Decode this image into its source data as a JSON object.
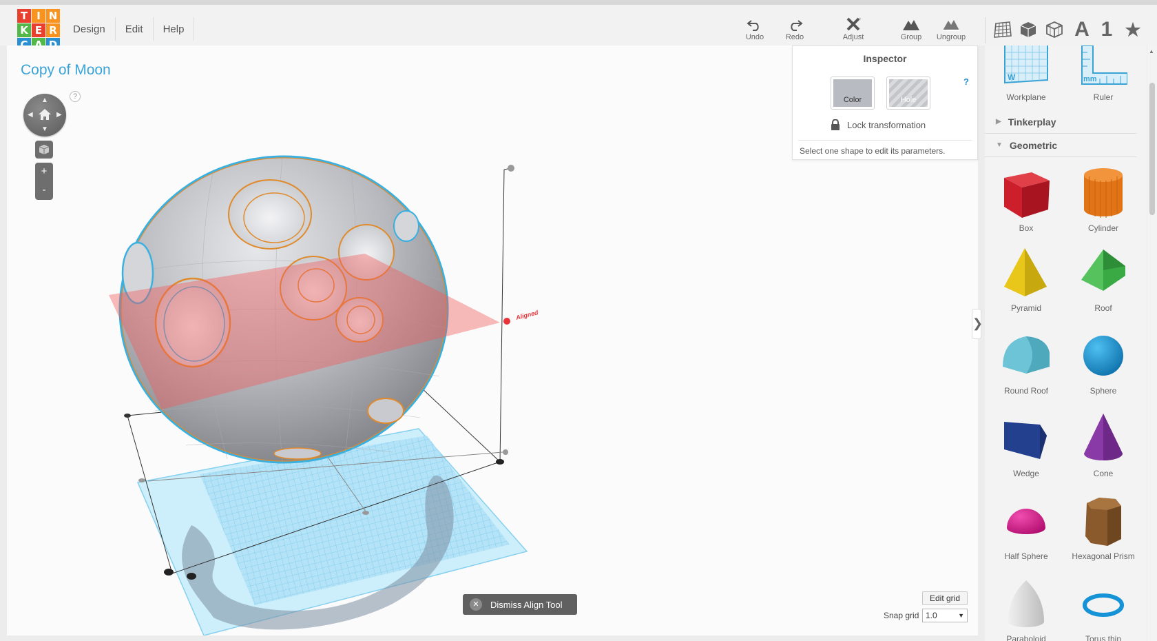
{
  "app": {
    "logo_letters": [
      "T",
      "I",
      "N",
      "K",
      "E",
      "R",
      "C",
      "A",
      "D"
    ],
    "logo_colors": [
      "#e8402c",
      "#f7931e",
      "#f7931e",
      "#52b848",
      "#e8402c",
      "#f7931e",
      "#2a8fd0",
      "#52b848",
      "#2a8fd0"
    ]
  },
  "menu": {
    "design": "Design",
    "edit": "Edit",
    "help": "Help"
  },
  "toolbar": {
    "undo": "Undo",
    "redo": "Redo",
    "adjust": "Adjust",
    "group": "Group",
    "ungroup": "Ungroup",
    "view_text": "A",
    "view_number": "1",
    "view_star": "★"
  },
  "design_title": "Copy of Moon",
  "navigation": {
    "help": "?",
    "zoom_in": "+",
    "zoom_out": "-"
  },
  "inspector": {
    "title": "Inspector",
    "color_label": "Color",
    "hole_label": "Hole",
    "help": "?",
    "lock_label": "Lock transformation",
    "message": "Select one shape to edit its parameters."
  },
  "scene": {
    "aligned_label": "Aligned"
  },
  "dismiss_label": "Dismiss Align Tool",
  "grid": {
    "edit_label": "Edit grid",
    "snap_label": "Snap grid",
    "snap_value": "1.0"
  },
  "panel": {
    "helpers": [
      {
        "label": "Workplane"
      },
      {
        "label": "Ruler"
      }
    ],
    "categories": [
      {
        "label": "Tinkerplay",
        "expanded": false
      },
      {
        "label": "Geometric",
        "expanded": true
      }
    ],
    "shapes": [
      {
        "label": "Box",
        "color": "#cc1f2b"
      },
      {
        "label": "Cylinder",
        "color": "#e07417"
      },
      {
        "label": "Pyramid",
        "color": "#e8c61a"
      },
      {
        "label": "Roof",
        "color": "#3aaa45"
      },
      {
        "label": "Round Roof",
        "color": "#6cc4d6"
      },
      {
        "label": "Sphere",
        "color": "#1593d6"
      },
      {
        "label": "Wedge",
        "color": "#23408e"
      },
      {
        "label": "Cone",
        "color": "#8a3aa6"
      },
      {
        "label": "Half Sphere",
        "color": "#d91a8a"
      },
      {
        "label": "Hexagonal Prism",
        "color": "#8a5a2c"
      },
      {
        "label": "Paraboloid",
        "color": "#d8d8d8"
      },
      {
        "label": "Torus thin",
        "color": "#1593d6"
      }
    ]
  },
  "colors": {
    "accent": "#3aa3d6",
    "selection": "#3ab0e0",
    "aligned": "#e8343a"
  }
}
